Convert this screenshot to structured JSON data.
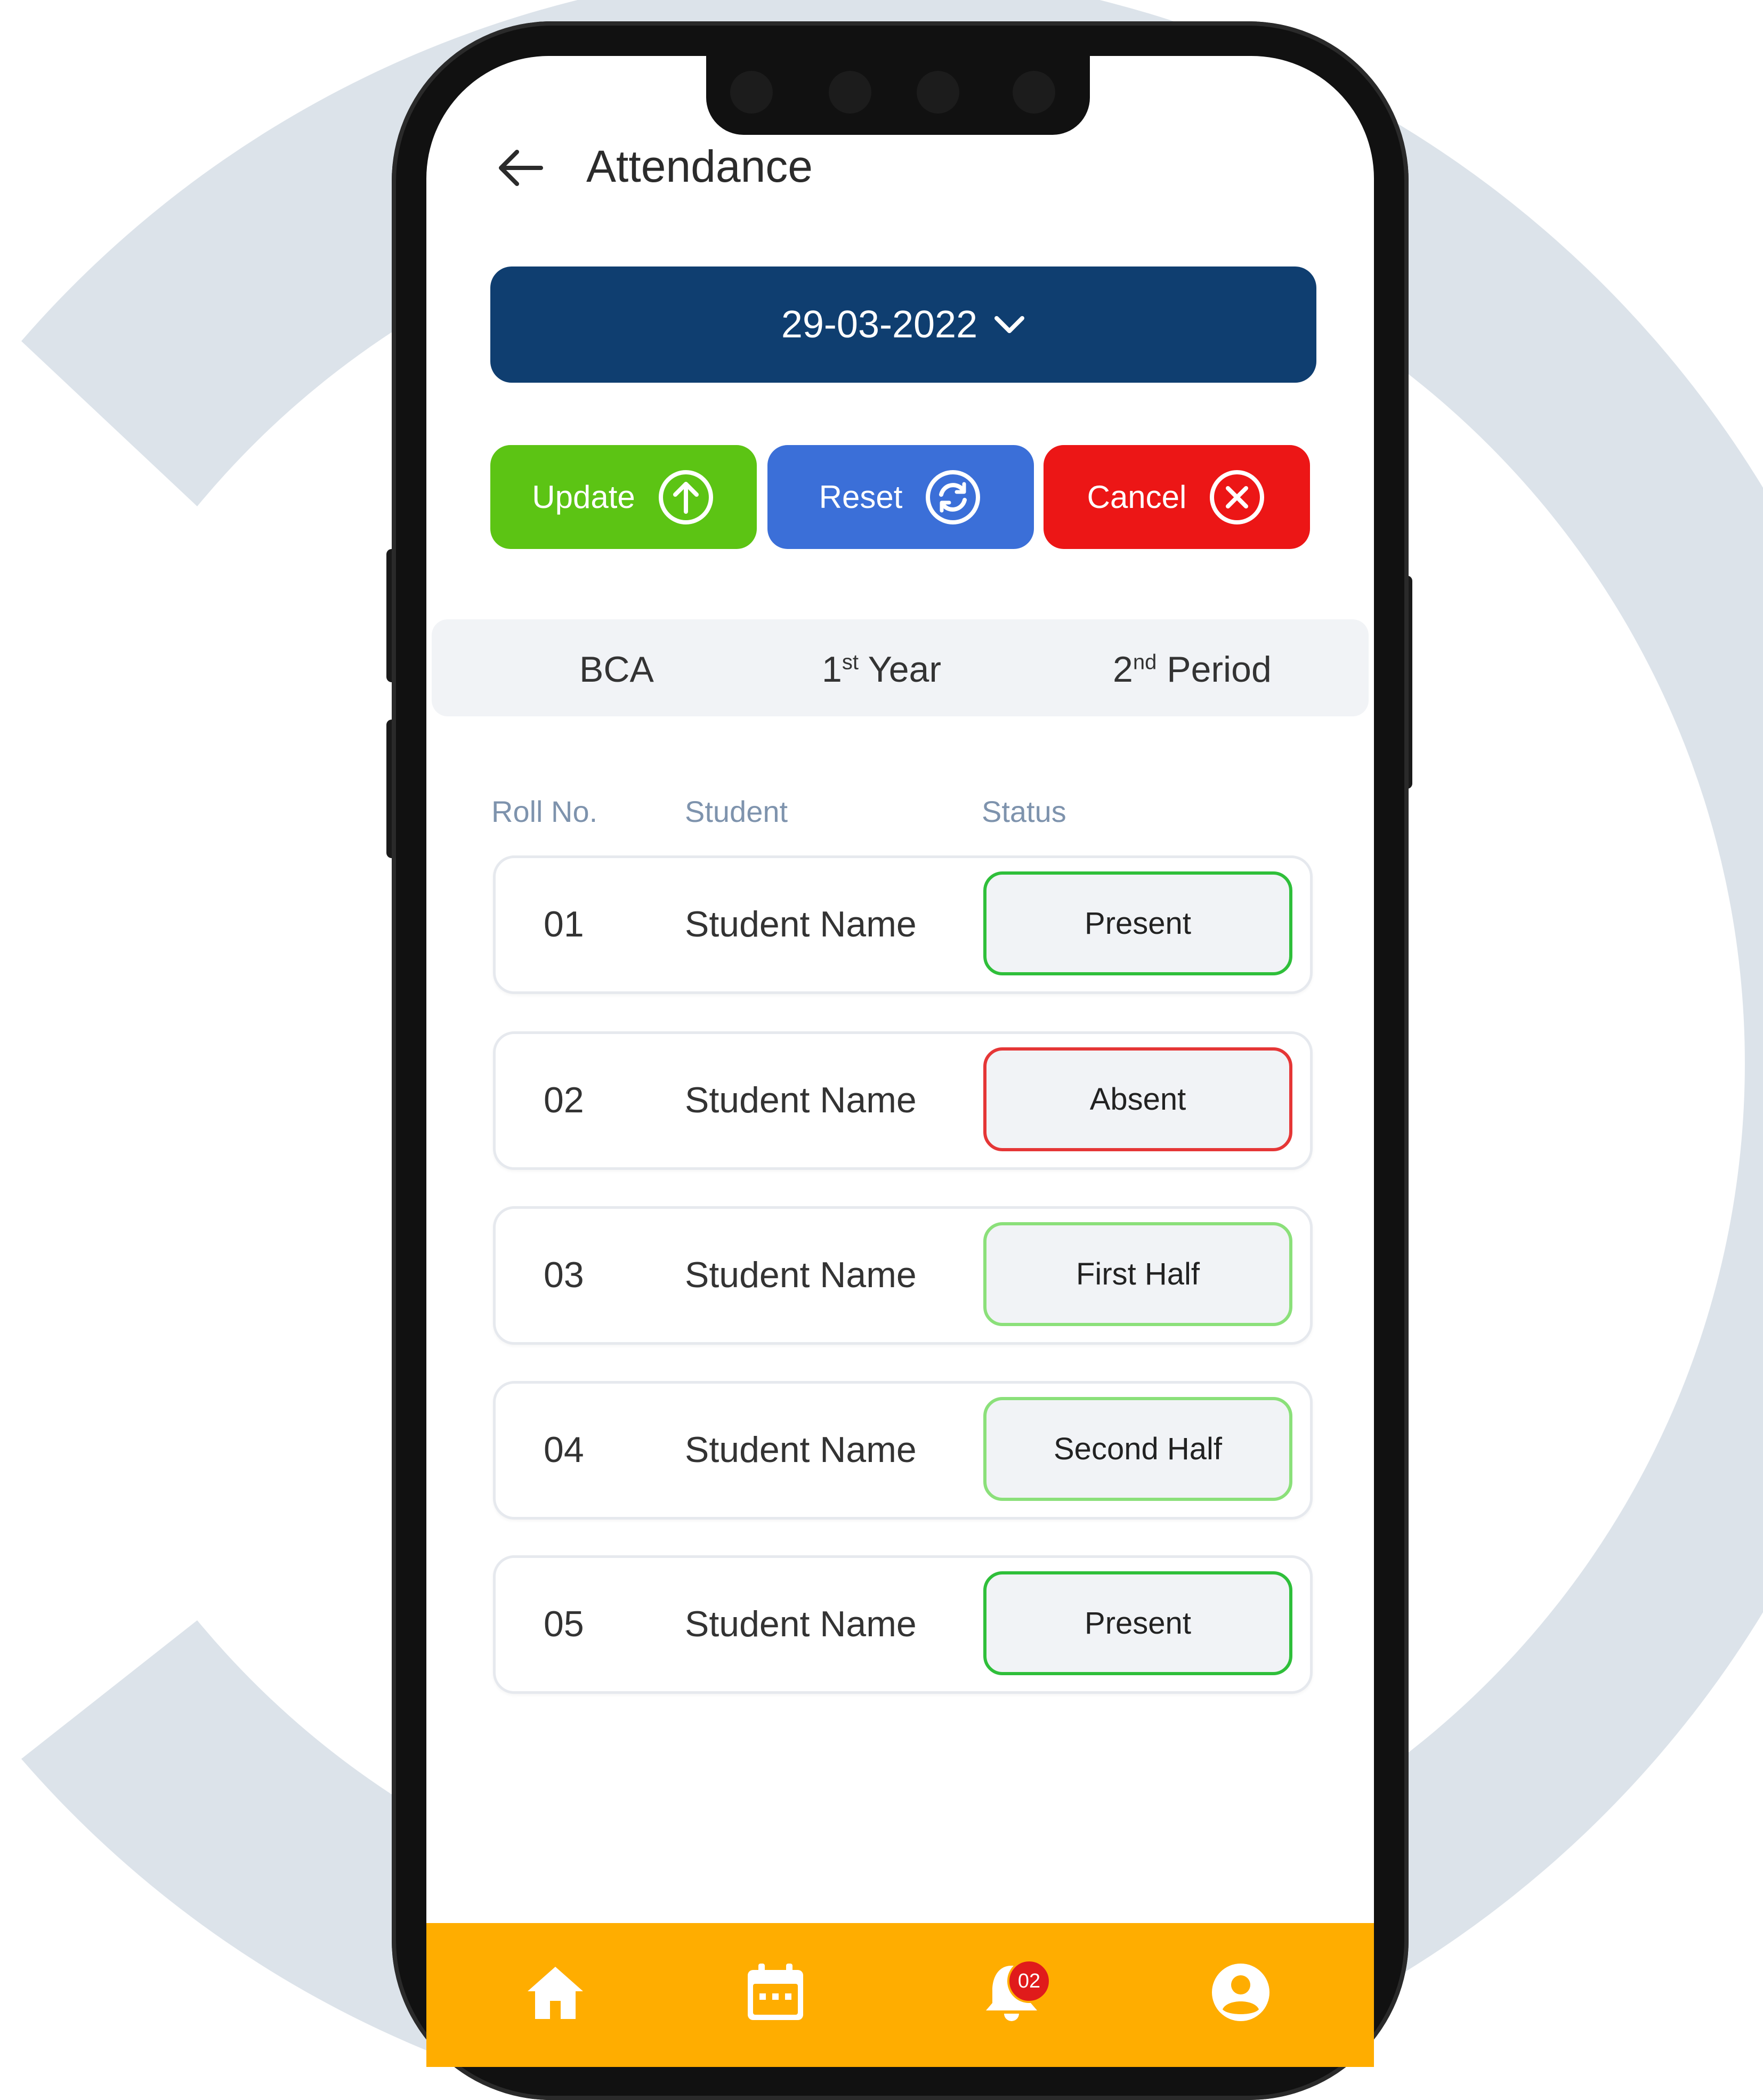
{
  "header": {
    "title": "Attendance"
  },
  "date_selector": {
    "value": "29-03-2022"
  },
  "actions": {
    "update_label": "Update",
    "reset_label": "Reset",
    "cancel_label": "Cancel"
  },
  "info": {
    "course": "BCA",
    "year_num": "1",
    "year_suffix": "st",
    "year_word": "Year",
    "period_num": "2",
    "period_suffix": "nd",
    "period_word": "Period"
  },
  "columns": {
    "roll": "Roll No.",
    "student": "Student",
    "status": "Status"
  },
  "rows": [
    {
      "roll": "01",
      "name": "Student Name",
      "status": "Present"
    },
    {
      "roll": "02",
      "name": "Student Name",
      "status": "Absent"
    },
    {
      "roll": "03",
      "name": "Student Name",
      "status": "First Half"
    },
    {
      "roll": "04",
      "name": "Student Name",
      "status": "Second Half"
    },
    {
      "roll": "05",
      "name": "Student Name",
      "status": "Present"
    }
  ],
  "bottom_nav": {
    "items": [
      "home-icon",
      "calendar-icon",
      "bell-icon",
      "profile-icon"
    ],
    "notification_count": "02"
  },
  "colors": {
    "date_bar": "#0f3e70",
    "update": "#5cc414",
    "reset": "#3b6fd8",
    "cancel": "#ec1616",
    "nav": "#ffad00",
    "present_border": "#2fbf3a",
    "absent_border": "#e53636",
    "half_border": "#8be07a"
  }
}
